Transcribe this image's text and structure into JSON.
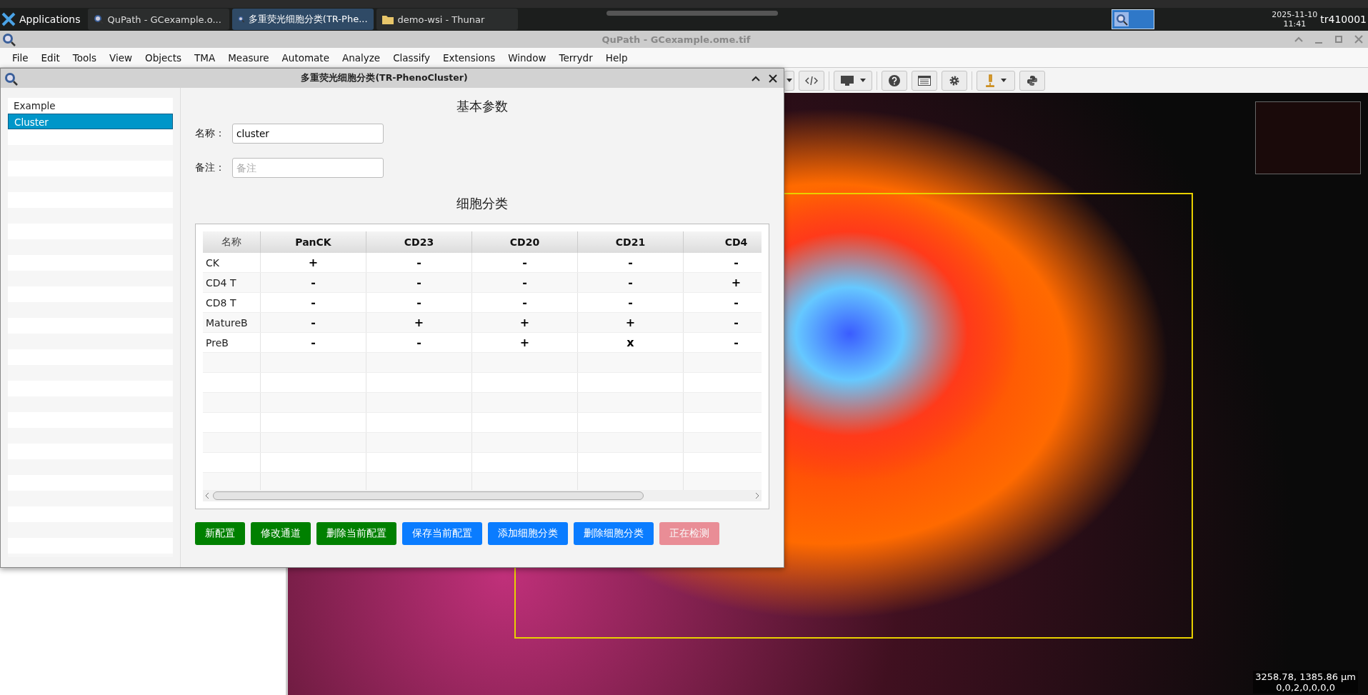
{
  "taskbar": {
    "menu_label": "Applications",
    "tasks": [
      {
        "label": "QuPath - GCexample.o...",
        "selected": false
      },
      {
        "label": "多重荧光细胞分类(TR-Phe...",
        "selected": true
      },
      {
        "label": "demo-wsi - Thunar",
        "selected": false
      }
    ],
    "date": "2025-11-10",
    "time": "11:41",
    "user": "tr410001"
  },
  "window": {
    "title": "QuPath - GCexample.ome.tif"
  },
  "menu": [
    "File",
    "Edit",
    "Tools",
    "View",
    "Objects",
    "TMA",
    "Measure",
    "Automate",
    "Analyze",
    "Classify",
    "Extensions",
    "Window",
    "Terrydr",
    "Help"
  ],
  "dialog": {
    "title": "多重荧光细胞分类(TR-PhenoCluster)",
    "configs": [
      {
        "label": "Example",
        "selected": false
      },
      {
        "label": "Cluster",
        "selected": true
      }
    ],
    "section_basic": "基本参数",
    "name_label": "名称：",
    "name_value": "cluster",
    "note_label": "备注：",
    "note_placeholder": "备注",
    "section_classes": "细胞分类",
    "table": {
      "columns": [
        "名称",
        "PanCK",
        "CD23",
        "CD20",
        "CD21",
        "CD4"
      ],
      "rows": [
        [
          "CK",
          "+",
          "-",
          "-",
          "-",
          "-"
        ],
        [
          "CD4 T",
          "-",
          "-",
          "-",
          "-",
          "+"
        ],
        [
          "CD8 T",
          "-",
          "-",
          "-",
          "-",
          "-"
        ],
        [
          "MatureB",
          "-",
          "+",
          "+",
          "+",
          "-"
        ],
        [
          "PreB",
          "-",
          "-",
          "+",
          "x",
          "-"
        ]
      ]
    },
    "buttons": [
      {
        "label": "新配置",
        "kind": "config",
        "disabled": false
      },
      {
        "label": "修改通道",
        "kind": "config",
        "disabled": false
      },
      {
        "label": "删除当前配置",
        "kind": "config",
        "disabled": false
      },
      {
        "label": "保存当前配置",
        "kind": "class",
        "disabled": false
      },
      {
        "label": "添加细胞分类",
        "kind": "class",
        "disabled": false
      },
      {
        "label": "删除细胞分类",
        "kind": "class",
        "disabled": false
      },
      {
        "label": "正在检测",
        "kind": "status",
        "disabled": true
      }
    ]
  },
  "viewer": {
    "cursor_position": "3258.78, 1385.86 µm",
    "cursor_channels": "0,0,2,0,0,0,0"
  }
}
